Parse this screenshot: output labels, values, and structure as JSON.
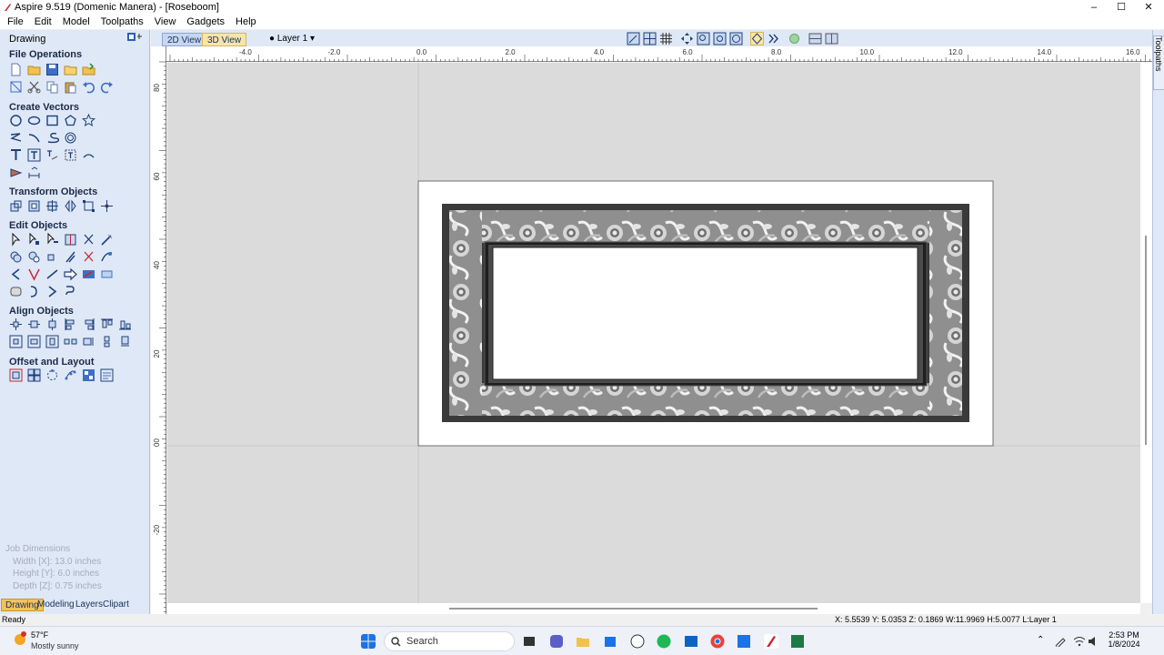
{
  "window": {
    "title": "Aspire 9.519 (Domenic Manera) - [Roseboom]",
    "controls": [
      "–",
      "☐",
      "✕"
    ]
  },
  "menu": [
    "File",
    "Edit",
    "Model",
    "Toolpaths",
    "View",
    "Gadgets",
    "Help"
  ],
  "left_panel": {
    "title": "Drawing",
    "sections": {
      "file_operations": "File Operations",
      "create_vectors": "Create Vectors",
      "transform_objects": "Transform Objects",
      "edit_objects": "Edit Objects",
      "align_objects": "Align Objects",
      "offset_layout": "Offset and Layout"
    },
    "job_dimensions": {
      "title": "Job Dimensions",
      "width": "Width  [X]: 13.0 inches",
      "height": "Height [Y]: 6.0 inches",
      "depth": "Depth  [Z]: 0.75 inches"
    },
    "bottom_tabs": [
      "Drawing",
      "Modeling",
      "Layers",
      "Clipart"
    ]
  },
  "view_tabs": {
    "tab_2d": "2D View",
    "tab_3d": "3D View",
    "layer": "Layer 1"
  },
  "right_toolbar": {
    "label": "Toolpaths"
  },
  "ruler": {
    "x_labels": [
      "-4.0",
      "-2.0",
      "0.0",
      "2.0",
      "4.0",
      "6.0",
      "8.0",
      "10.0",
      "12.0",
      "14.0",
      "16.0"
    ],
    "y_labels": [
      "80",
      "60",
      "40",
      "20",
      "00",
      "-20"
    ]
  },
  "status": {
    "left": "Ready",
    "coords": "X: 5.5539 Y: 5.0353 Z: 0.1869",
    "dims": "W:11.9969  H:5.0077  L:Layer 1"
  },
  "taskbar": {
    "weather_temp": "57°F",
    "weather_cond": "Mostly sunny",
    "search_placeholder": "Search",
    "time": "2:53 PM",
    "date": "1/8/2024"
  },
  "colors": {
    "panel_bg": "#dfe8f6",
    "canvas_bg": "#dbdbdb",
    "tab_active": "#f5c15c",
    "accent_blue": "#2b5fb4"
  }
}
